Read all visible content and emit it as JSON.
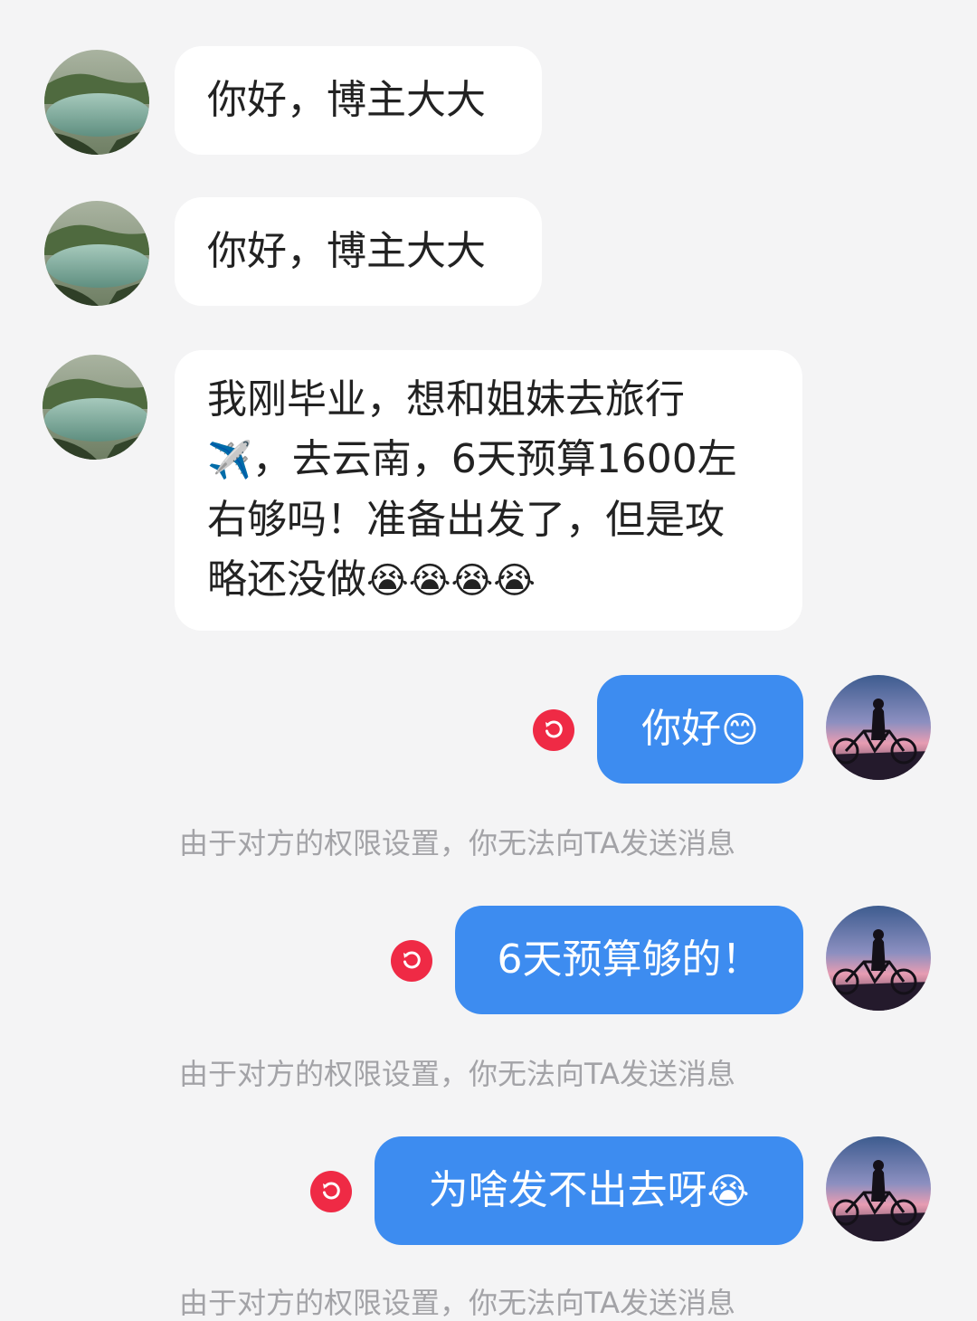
{
  "messages": [
    {
      "side": "received",
      "text": "你好，博主大大",
      "avatar": "lake-avatar"
    },
    {
      "side": "received",
      "text": "你好，博主大大",
      "avatar": "lake-avatar"
    },
    {
      "side": "received",
      "line1": "我刚毕业，想和姐妹去旅行",
      "line2_emoji": "✈️",
      "line2": "，去云南，6天预算1600左",
      "line3": "右够吗！准备出发了，但是攻",
      "line4": "略还没做",
      "line4_emoji": "😭😭😭😭",
      "avatar": "lake-avatar"
    },
    {
      "side": "sent",
      "text": "你好",
      "emoji": "😊",
      "status": "failed",
      "avatar": "bicycle-sunset-avatar"
    },
    {
      "side": "sent",
      "text": "6天预算够的！",
      "status": "failed",
      "avatar": "bicycle-sunset-avatar"
    },
    {
      "side": "sent",
      "text": "为啥发不出去呀",
      "emoji": "😭",
      "status": "failed",
      "avatar": "bicycle-sunset-avatar"
    }
  ],
  "system_notice": "由于对方的权限设置，你无法向TA发送消息",
  "colors": {
    "background": "#f4f4f5",
    "received_bubble": "#ffffff",
    "sent_bubble": "#3d8cf0",
    "retry_badge": "#ef2a45",
    "notice_text": "#a3a3a7"
  },
  "icons": {
    "retry": "retry-icon"
  }
}
